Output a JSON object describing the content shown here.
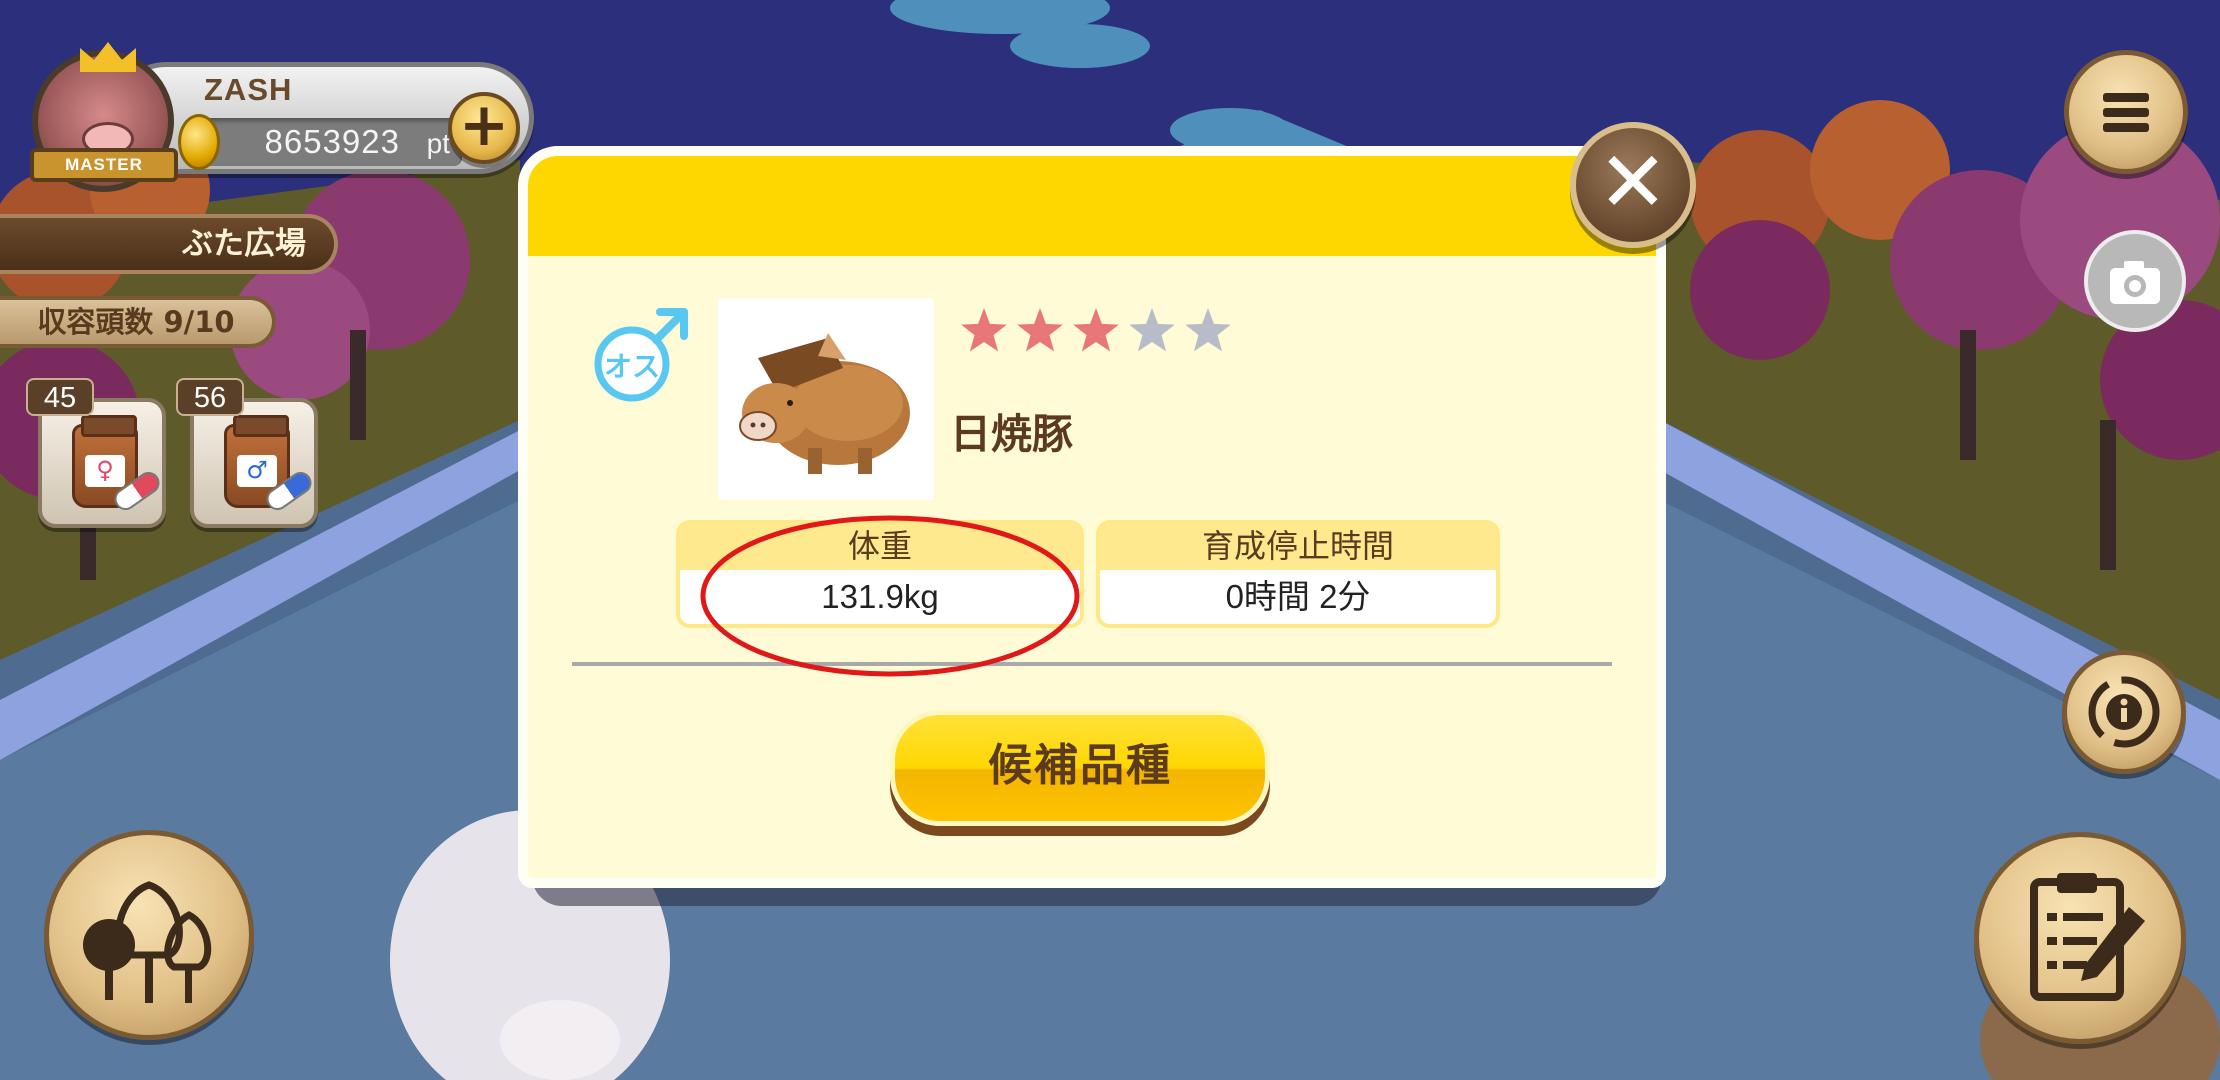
{
  "player": {
    "name": "ZASH",
    "points": "8653923",
    "points_unit": "pt",
    "add_label": "+",
    "rank_badge": "MASTER"
  },
  "area": {
    "name": "ぶた広場",
    "capacity": "収容頭数 9/10"
  },
  "items": [
    {
      "count": "45",
      "icon": "female-medicine-icon",
      "symbol": "♀"
    },
    {
      "count": "56",
      "icon": "male-medicine-icon",
      "symbol": "♂"
    }
  ],
  "dialog": {
    "close_label": "✕",
    "gender_icon": "male-symbol-icon",
    "gender_text": "オス",
    "rating": {
      "filled": 3,
      "total": 5
    },
    "breed_name": "日焼豚",
    "stats": [
      {
        "label": "体重",
        "value": "131.9kg"
      },
      {
        "label": "育成停止時間",
        "value": "0時間 2分"
      }
    ],
    "candidate_button": "候補品種"
  },
  "side_buttons": {
    "menu_icon": "hamburger-menu-icon",
    "camera_icon": "camera-icon",
    "rotate_icon": "rotate-info-icon",
    "trees_icon": "trees-icon",
    "clipboard_icon": "clipboard-edit-icon"
  },
  "colors": {
    "header_yellow": "#ffd700",
    "dialog_bg": "#fffbd7",
    "text_brown": "#5b3a1e",
    "star_filled": "#e87878",
    "star_empty": "#b8bcc8",
    "gender_blue": "#58c8f0",
    "highlight_red": "#e01818"
  }
}
